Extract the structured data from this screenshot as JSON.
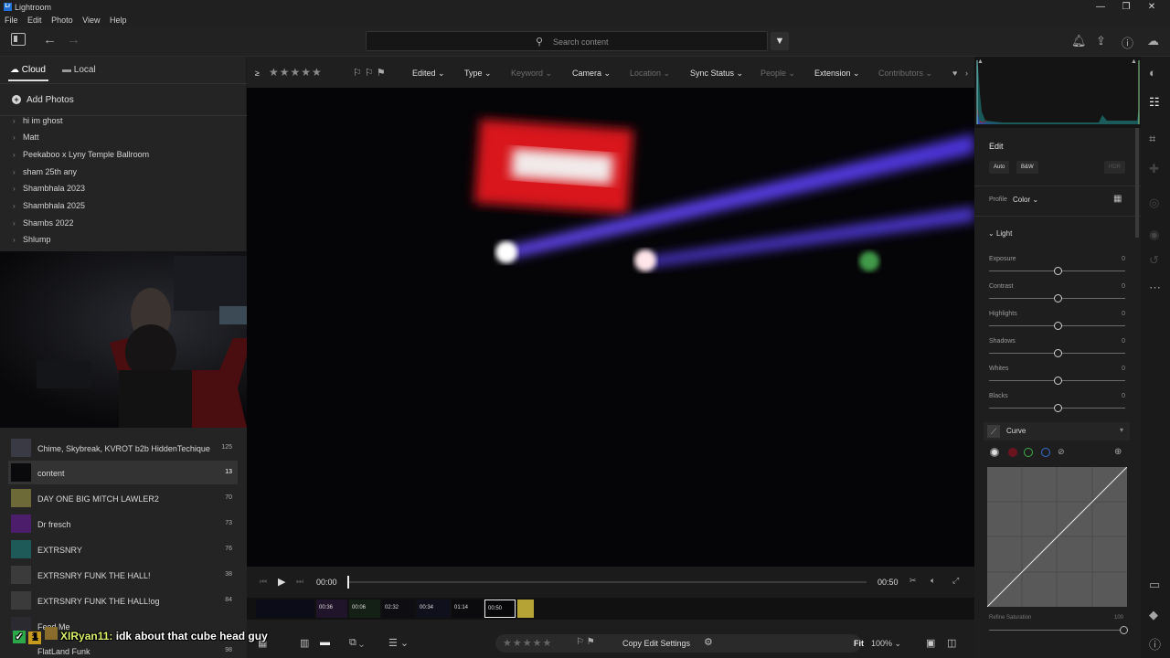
{
  "window": {
    "title": "Lightroom",
    "logo": "Lr"
  },
  "menu": [
    "File",
    "Edit",
    "Photo",
    "View",
    "Help"
  ],
  "search": {
    "placeholder": "Search content"
  },
  "tabs": {
    "cloud": "Cloud",
    "local": "Local"
  },
  "add_photos": "Add Photos",
  "albums": [
    "hi im ghost",
    "Matt",
    "Peekaboo x Lyny Temple Ballroom",
    "sham 25th any",
    "Shambhala 2023",
    "Shambhala 2025",
    "Shambs 2022",
    "Shlump"
  ],
  "list": [
    {
      "name": "Chime, Skybreak, KVROT b2b HiddenTechique",
      "count": "125"
    },
    {
      "name": "content",
      "count": "13"
    },
    {
      "name": "DAY ONE BIG MITCH LAWLER2",
      "count": "70"
    },
    {
      "name": "Dr fresch",
      "count": "73"
    },
    {
      "name": "EXTRSNRY",
      "count": "76"
    },
    {
      "name": "EXTRSNRY FUNK THE HALL!",
      "count": "38"
    },
    {
      "name": "EXTRSNRY FUNK THE HALL!og",
      "count": "84"
    },
    {
      "name": "Feed Me",
      "count": ""
    },
    {
      "name": "FlatLand Funk",
      "count": "98"
    }
  ],
  "filterbar": {
    "ge": "≥",
    "stars": "★★★★★",
    "edited": "Edited",
    "type": "Type",
    "keyword": "Keyword",
    "camera": "Camera",
    "location": "Location",
    "sync": "Sync Status",
    "people": "People",
    "extension": "Extension",
    "contributors": "Contributors"
  },
  "transport": {
    "current": "00:00",
    "duration": "00:50"
  },
  "filmstrip": [
    "00:36",
    "00:06",
    "02:32",
    "00:34",
    "01:14",
    "00:50"
  ],
  "bottombar": {
    "stars": "★★★★★",
    "copy": "Copy Edit Settings",
    "fit": "Fit",
    "zoom": "100%"
  },
  "chat": {
    "user": "XIRyan11:",
    "message": "idk about that cube head guy",
    "prefix": "1"
  },
  "edit": {
    "title": "Edit",
    "auto": "Auto",
    "bw": "B&W",
    "hdr": "HDR",
    "profile_label": "Profile",
    "profile_value": "Color",
    "light": "Light",
    "sliders": [
      {
        "label": "Exposure",
        "value": "0"
      },
      {
        "label": "Contrast",
        "value": "0"
      },
      {
        "label": "Highlights",
        "value": "0"
      },
      {
        "label": "Shadows",
        "value": "0"
      },
      {
        "label": "Whites",
        "value": "0"
      },
      {
        "label": "Blacks",
        "value": "0"
      }
    ],
    "curve": "Curve",
    "refine_label": "Refine Saturation",
    "refine_value": "100"
  },
  "colors": {
    "accent": "#1f6fd6",
    "panel": "#242424",
    "viewer": "#050407"
  }
}
